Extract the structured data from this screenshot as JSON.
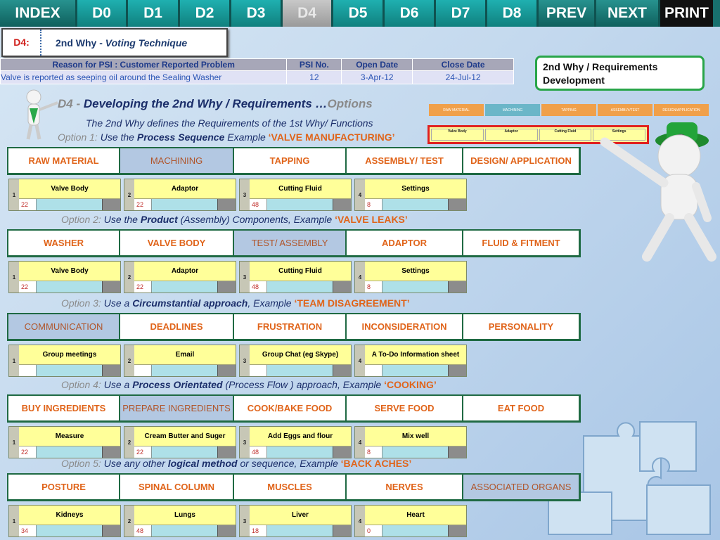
{
  "nav": [
    {
      "label": "INDEX",
      "width": 110,
      "style": "dark"
    },
    {
      "label": "D0",
      "width": 72,
      "style": ""
    },
    {
      "label": "D1",
      "width": 74,
      "style": ""
    },
    {
      "label": "D2",
      "width": 73,
      "style": ""
    },
    {
      "label": "D3",
      "width": 73,
      "style": ""
    },
    {
      "label": "D4",
      "width": 72,
      "style": "active"
    },
    {
      "label": "D5",
      "width": 73,
      "style": ""
    },
    {
      "label": "D6",
      "width": 73,
      "style": ""
    },
    {
      "label": "D7",
      "width": 73,
      "style": ""
    },
    {
      "label": "D8",
      "width": 73,
      "style": ""
    },
    {
      "label": "PREV",
      "width": 82,
      "style": "dark"
    },
    {
      "label": "NEXT",
      "width": 91,
      "style": "dark"
    },
    {
      "label": "PRINT",
      "width": 75,
      "style": "print"
    }
  ],
  "d4": {
    "label": "D4:",
    "title_prefix": "2nd Why - ",
    "title_em": "Voting Technique"
  },
  "psi": {
    "headers": [
      "Reason for PSI   : Customer Reported Problem",
      "PSI No.",
      "Open Date",
      "Close Date"
    ],
    "row": [
      "Valve is reported as seeping oil around the Sealing Washer",
      "12",
      "3-Apr-12",
      "24-Jul-12"
    ]
  },
  "req_box": {
    "line1": "2nd Why / Requirements",
    "line2": "Development"
  },
  "heading": {
    "prefix": "D4 - ",
    "main": "Developing the 2nd Why / Requirements …",
    "tail": "Options"
  },
  "subheading": "The 2nd Why defines the Requirements of the 1st Why/ Functions",
  "options": [
    {
      "lead": "Option 1:",
      "text": " Use the ",
      "bold": "Process Sequence",
      "text2": " Example ",
      "example": "‘VALVE MANUFACTURING’",
      "categories": [
        "RAW MATERIAL",
        "MACHINING",
        "TAPPING",
        "ASSEMBLY/ TEST",
        "DESIGN/ APPLICATION"
      ],
      "selected": 1,
      "items": [
        {
          "n": "1",
          "t": "Valve Body",
          "v": "22"
        },
        {
          "n": "2",
          "t": "Adaptor",
          "v": "22"
        },
        {
          "n": "3",
          "t": "Cutting Fluid",
          "v": "48"
        },
        {
          "n": "4",
          "t": "Settings",
          "v": "8"
        }
      ]
    },
    {
      "lead": "Option 2:",
      "text": " Use the ",
      "bold": "Product",
      "text2": " (Assembly) Components, Example ",
      "example": "‘VALVE LEAKS’",
      "categories": [
        "WASHER",
        "VALVE BODY",
        "TEST/ ASSEMBLY",
        "ADAPTOR",
        "FLUID & FITMENT"
      ],
      "selected": 2,
      "items": [
        {
          "n": "1",
          "t": "Valve Body",
          "v": "22"
        },
        {
          "n": "2",
          "t": "Adaptor",
          "v": "22"
        },
        {
          "n": "3",
          "t": "Cutting Fluid",
          "v": "48"
        },
        {
          "n": "4",
          "t": "Settings",
          "v": "8"
        }
      ]
    },
    {
      "lead": "Option 3:",
      "text": " Use a ",
      "bold": "Circumstantial approach",
      "text2": ", Example ",
      "example": "‘TEAM DISAGREEMENT’",
      "categories": [
        "COMMUNICATION",
        "DEADLINES",
        "FRUSTRATION",
        "INCONSIDERATION",
        "PERSONALITY"
      ],
      "selected": 0,
      "items": [
        {
          "n": "1",
          "t": "Group meetings",
          "v": ""
        },
        {
          "n": "2",
          "t": "Email",
          "v": ""
        },
        {
          "n": "3",
          "t": "Group Chat (eg Skype)",
          "v": ""
        },
        {
          "n": "4",
          "t": "A To-Do Information sheet",
          "v": ""
        }
      ]
    },
    {
      "lead": "Option 4:",
      "text": " Use a ",
      "bold": "Process Orientated",
      "text2": "  (Process Flow ) approach, Example ",
      "example": "‘COOKING’",
      "categories": [
        "BUY INGREDIENTS",
        "PREPARE INGREDIENTS",
        "COOK/BAKE FOOD",
        "SERVE FOOD",
        "EAT FOOD"
      ],
      "selected": 1,
      "items": [
        {
          "n": "1",
          "t": "Measure",
          "v": "22"
        },
        {
          "n": "2",
          "t": "Cream Butter and Suger",
          "v": "22"
        },
        {
          "n": "3",
          "t": "Add Eggs and flour",
          "v": "48"
        },
        {
          "n": "4",
          "t": "Mix well",
          "v": "8"
        }
      ]
    },
    {
      "lead": "Option  5:",
      "text": " Use any other ",
      "bold": "logical method",
      "text2": " or sequence, Example ",
      "example": "‘BACK ACHES’",
      "categories": [
        "POSTURE",
        "SPINAL COLUMN",
        "MUSCLES",
        "NERVES",
        "ASSOCIATED ORGANS"
      ],
      "selected": 4,
      "items": [
        {
          "n": "1",
          "t": "Kidneys",
          "v": "34"
        },
        {
          "n": "2",
          "t": "Lungs",
          "v": "48"
        },
        {
          "n": "3",
          "t": "Liver",
          "v": "18"
        },
        {
          "n": "4",
          "t": "Heart",
          "v": "0"
        }
      ]
    }
  ],
  "mini": {
    "categories": [
      "RAW MATERIAL",
      "MACHINING",
      "TAPPING",
      "ASSEMBLY/TEST",
      "DESIGN/APPLICATION"
    ],
    "select_label": "SELECT",
    "items": [
      "Valve Body",
      "Adaptor",
      "Cutting Fluid",
      "Settings"
    ]
  },
  "colors": {
    "accent": "#e0641a",
    "nav": "#1fb0b0",
    "heading": "#1b2e6a",
    "selected_cat": "#b3c8e2"
  }
}
